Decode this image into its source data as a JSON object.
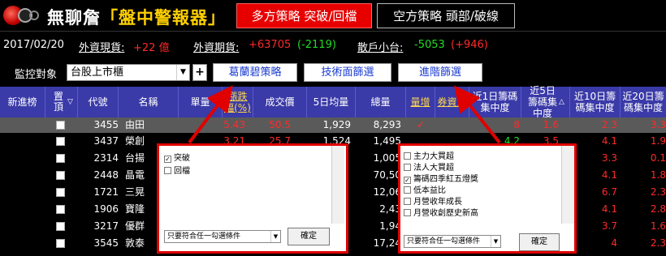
{
  "app": {
    "title_main": "無聊詹",
    "title_sub": "「盤中警報器」",
    "tabs": [
      {
        "label": "多方策略 突破/回檔",
        "active": true
      },
      {
        "label": "空方策略 頭部/破線",
        "active": false
      }
    ]
  },
  "info": {
    "date": "2017/02/20",
    "spot_label": "外資現貨:",
    "spot_value": "+22 億",
    "futures_label": "外資期貨:",
    "futures_value_red": "+63705",
    "futures_value_green": "(-2119)",
    "retail_label": "散戶小台:",
    "retail_value_green": "-5053",
    "retail_value_red": "(+946)"
  },
  "controls": {
    "monitor_label": "監控對象",
    "monitor_value": "台股上市櫃",
    "plus": "+",
    "buttons": [
      "葛蘭碧策略",
      "技術面篩選",
      "進階篩選"
    ]
  },
  "table": {
    "headers": [
      "新進榜",
      "置頂",
      "代號",
      "名稱",
      "單量",
      "漲跌 幅(%)",
      "成交價",
      "5日均量",
      "總量",
      "量增",
      "券資比",
      "近1日籌碼集中度",
      "近5日籌碼集中度",
      "近10日籌碼集中度",
      "近20日籌碼集中度"
    ],
    "rows": [
      {
        "code": "3455",
        "name": "由田",
        "unit": "",
        "chg": "5.43",
        "price": "50.5",
        "avg5": "1,929",
        "total": "8,293",
        "vol_up": "✓",
        "c1": "8",
        "c5": "1.6",
        "c10": "2.3",
        "c20": "3.3",
        "selected": true
      },
      {
        "code": "3437",
        "name": "榮創",
        "unit": "",
        "chg": "3.21",
        "price": "25.7",
        "avg5": "1,524",
        "total": "1,495",
        "vol_up": "",
        "c1": "4.2",
        "c5": "3.5",
        "c10": "4.1",
        "c20": "1.9",
        "selected": false
      },
      {
        "code": "2314",
        "name": "台揚",
        "unit": "",
        "chg": "",
        "price": "",
        "avg5": "",
        "total": "1,005",
        "vol_up": "",
        "c1": "",
        "c5": "",
        "c10": "3.3",
        "c20": "0.1",
        "selected": false
      },
      {
        "code": "2448",
        "name": "晶電",
        "unit": "",
        "chg": "",
        "price": "",
        "avg5": "",
        "total": "70,50",
        "vol_up": "",
        "c1": "",
        "c5": "",
        "c10": "4.1",
        "c20": "1.8",
        "selected": false
      },
      {
        "code": "1721",
        "name": "三晃",
        "unit": "",
        "chg": "",
        "price": "",
        "avg5": "",
        "total": "12,06",
        "vol_up": "",
        "c1": "",
        "c5": "",
        "c10": "6.7",
        "c20": "2.3",
        "selected": false
      },
      {
        "code": "1906",
        "name": "寶隆",
        "unit": "",
        "chg": "",
        "price": "",
        "avg5": "",
        "total": "2,43",
        "vol_up": "",
        "c1": "",
        "c5": "",
        "c10": "4.1",
        "c20": "2.8",
        "selected": false
      },
      {
        "code": "3217",
        "name": "優群",
        "unit": "",
        "chg": "",
        "price": "",
        "avg5": "",
        "total": "1,94",
        "vol_up": "",
        "c1": "",
        "c5": "",
        "c10": "3.7",
        "c20": "1.6",
        "selected": false
      },
      {
        "code": "3545",
        "name": "敦泰",
        "unit": "",
        "chg": "",
        "price": "",
        "avg5": "",
        "total": "17,24",
        "vol_up": "",
        "c1": "",
        "c5": "",
        "c10": "4",
        "c20": "2.3",
        "selected": false
      }
    ]
  },
  "popup_left": {
    "options": [
      {
        "label": "突破",
        "checked": true
      },
      {
        "label": "回檔",
        "checked": false
      }
    ],
    "mode": "只要符合任一勾選條件",
    "confirm": "確定"
  },
  "popup_right": {
    "options": [
      {
        "label": "主力大買超",
        "checked": false
      },
      {
        "label": "法人大買超",
        "checked": false
      },
      {
        "label": "籌碼四季紅五燈獎",
        "checked": true
      },
      {
        "label": "低本益比",
        "checked": false
      },
      {
        "label": "月營收年成長",
        "checked": false
      },
      {
        "label": "月營收創歷史新高",
        "checked": false
      }
    ],
    "mode": "只要符合任一勾選條件",
    "confirm": "確定"
  },
  "colors": {
    "accent_red": "#e60000",
    "header_blue": "#3a3aa8",
    "up_red": "#ff2a2a",
    "down_green": "#22dd22"
  }
}
